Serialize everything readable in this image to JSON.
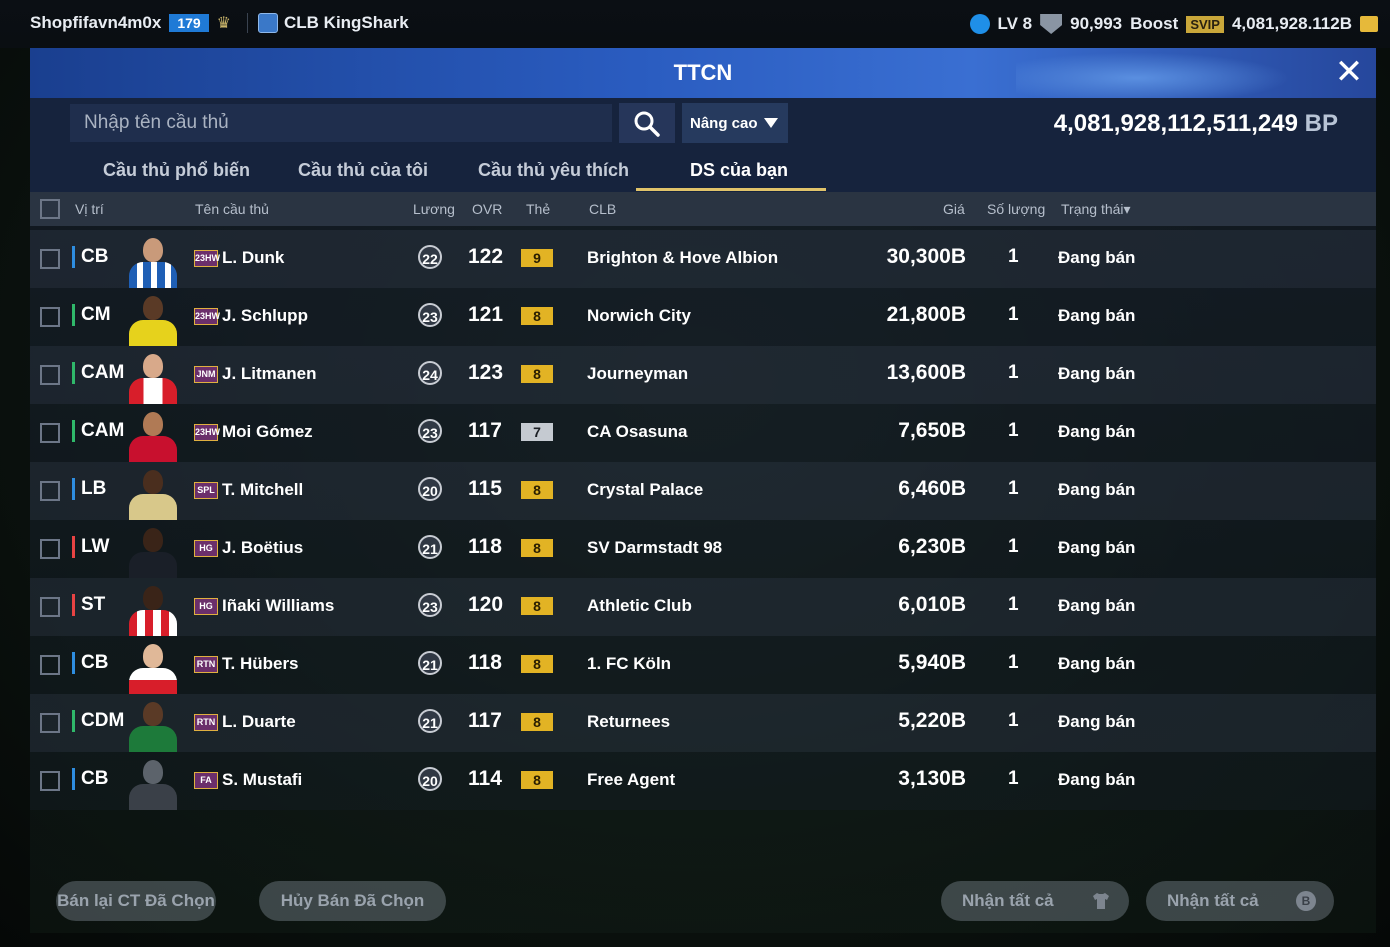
{
  "topbar": {
    "username": "Shopfifavn4m0x",
    "level_badge": "179",
    "club_name": "CLB KingShark",
    "lv": "LV 8",
    "points": "90,993",
    "boost_label": "Boost",
    "svip_label": "SVIP",
    "currency": "4,081,928.112B"
  },
  "panel": {
    "title": "TTCN",
    "search_placeholder": "Nhập tên cầu thủ",
    "advanced_label": "Nâng cao",
    "bp_amount": "4,081,928,112,511,249",
    "bp_unit": "BP"
  },
  "tabs": [
    {
      "label": "Cầu thủ phổ biến"
    },
    {
      "label": "Cầu thủ của tôi"
    },
    {
      "label": "Cầu thủ yêu thích"
    },
    {
      "label": "DS của bạn"
    }
  ],
  "columns": {
    "position": "Vị trí",
    "name": "Tên cầu thủ",
    "wage": "Lương",
    "ovr": "OVR",
    "grade": "Thẻ",
    "club": "CLB",
    "price": "Giá",
    "quantity": "Số lượng",
    "status": "Trạng thái▾"
  },
  "rows": [
    {
      "pos": "CB",
      "season": "23HW",
      "name": "L. Dunk",
      "wage": "22",
      "ovr": "122",
      "grade": "9",
      "club": "Brighton & Hove Albion",
      "price": "30,300B",
      "qty": "1",
      "status": "Đang bán"
    },
    {
      "pos": "CM",
      "season": "23HW",
      "name": "J. Schlupp",
      "wage": "23",
      "ovr": "121",
      "grade": "8",
      "club": "Norwich City",
      "price": "21,800B",
      "qty": "1",
      "status": "Đang bán"
    },
    {
      "pos": "CAM",
      "season": "JNM",
      "name": "J. Litmanen",
      "wage": "24",
      "ovr": "123",
      "grade": "8",
      "club": "Journeyman",
      "price": "13,600B",
      "qty": "1",
      "status": "Đang bán"
    },
    {
      "pos": "CAM",
      "season": "23HW",
      "name": "Moi Gómez",
      "wage": "23",
      "ovr": "117",
      "grade": "7",
      "club": "CA Osasuna",
      "price": "7,650B",
      "qty": "1",
      "status": "Đang bán"
    },
    {
      "pos": "LB",
      "season": "SPL",
      "name": "T. Mitchell",
      "wage": "20",
      "ovr": "115",
      "grade": "8",
      "club": "Crystal Palace",
      "price": "6,460B",
      "qty": "1",
      "status": "Đang bán"
    },
    {
      "pos": "LW",
      "season": "HG",
      "name": "J. Boëtius",
      "wage": "21",
      "ovr": "118",
      "grade": "8",
      "club": "SV Darmstadt 98",
      "price": "6,230B",
      "qty": "1",
      "status": "Đang bán"
    },
    {
      "pos": "ST",
      "season": "HG",
      "name": "Iñaki Williams",
      "wage": "23",
      "ovr": "120",
      "grade": "8",
      "club": "Athletic Club",
      "price": "6,010B",
      "qty": "1",
      "status": "Đang bán"
    },
    {
      "pos": "CB",
      "season": "RTN",
      "name": "T. Hübers",
      "wage": "21",
      "ovr": "118",
      "grade": "8",
      "club": "1. FC Köln",
      "price": "5,940B",
      "qty": "1",
      "status": "Đang bán"
    },
    {
      "pos": "CDM",
      "season": "RTN",
      "name": "L. Duarte",
      "wage": "21",
      "ovr": "117",
      "grade": "8",
      "club": "Returnees",
      "price": "5,220B",
      "qty": "1",
      "status": "Đang bán"
    },
    {
      "pos": "CB",
      "season": "FA",
      "name": "S. Mustafi",
      "wage": "20",
      "ovr": "114",
      "grade": "8",
      "club": "Free Agent",
      "price": "3,130B",
      "qty": "1",
      "status": "Đang bán"
    }
  ],
  "buttons": {
    "resell": "Bán lại CT Đã Chọn",
    "cancel": "Hủy Bán Đã Chọn",
    "claim_all_1": "Nhận tất cả",
    "claim_all_2": "Nhận tất cả",
    "coin_glyph": "B"
  },
  "colors": {
    "accent_gold": "#e2b324",
    "header_blue": "#2a5cc0",
    "defender": "#2e8de0",
    "midfielder": "#2fb86a",
    "attacker": "#e84343"
  }
}
